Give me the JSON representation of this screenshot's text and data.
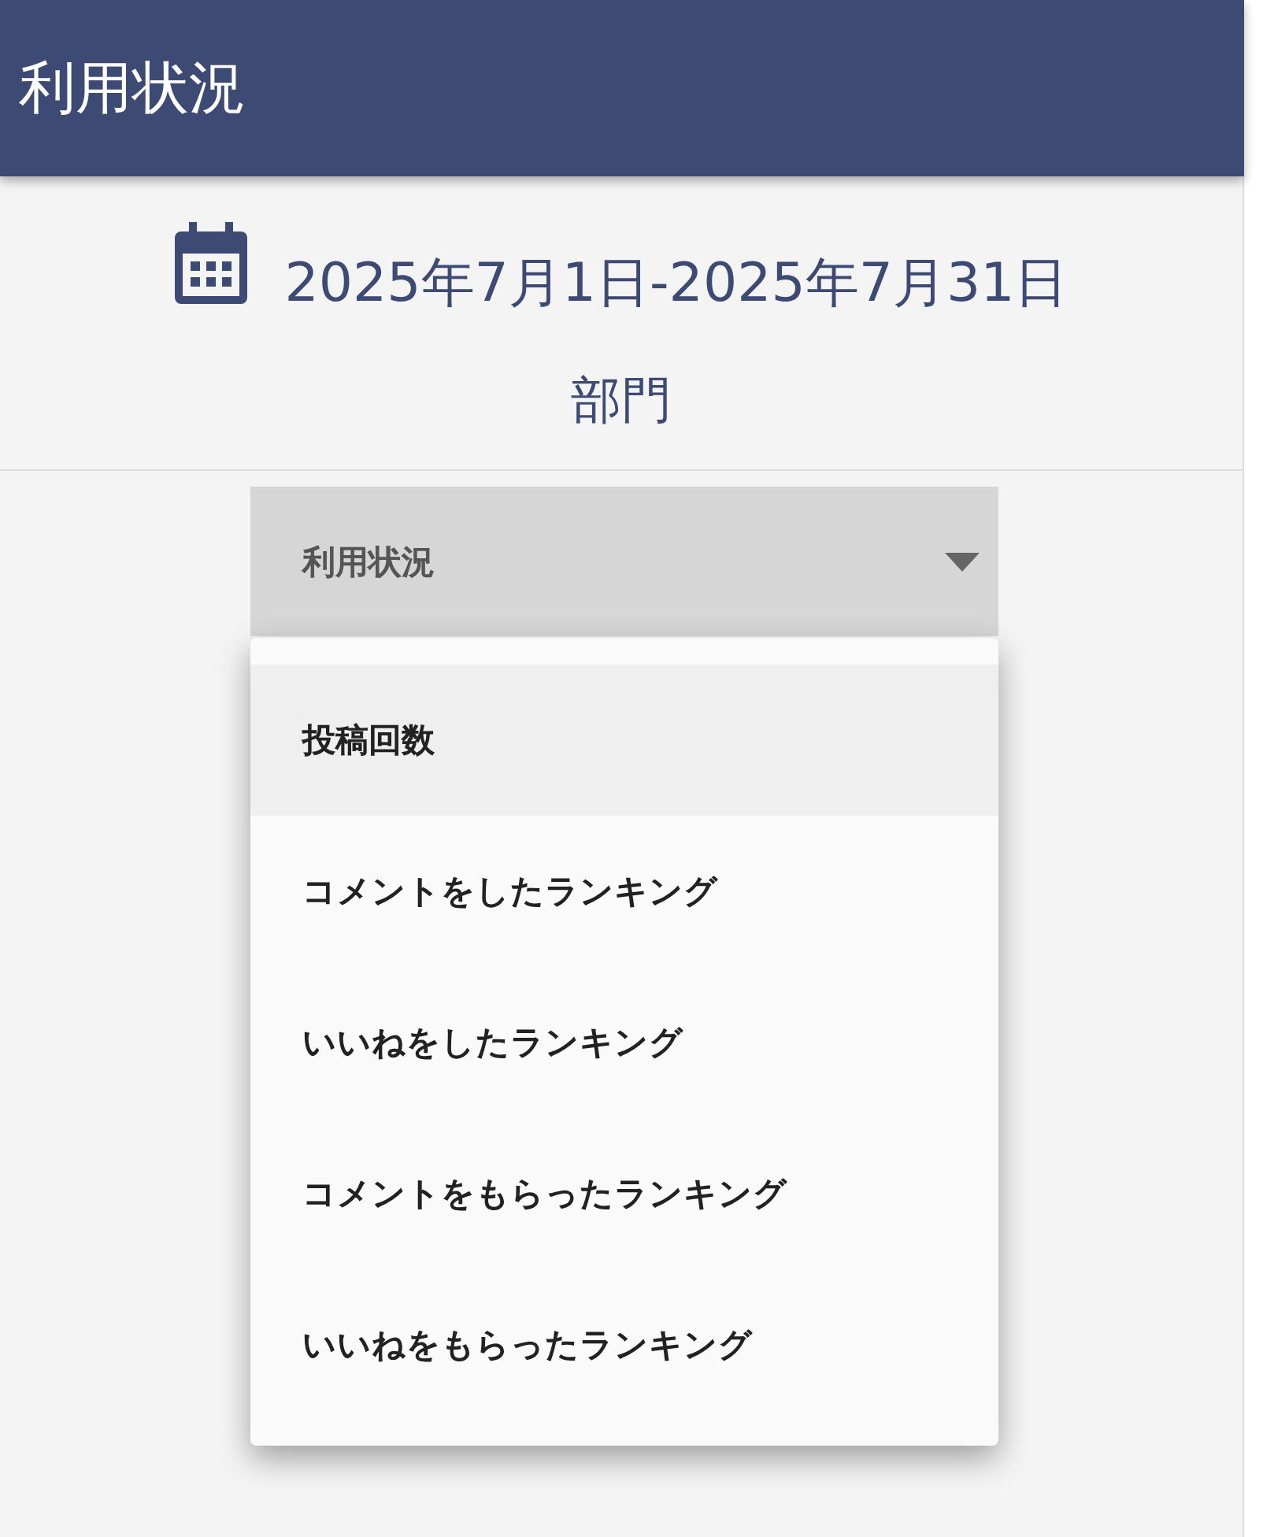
{
  "header": {
    "title": "利用状況"
  },
  "date_range": {
    "text": "2025年7月1日-2025年7月31日"
  },
  "department": {
    "label": "部門"
  },
  "select": {
    "value": "利用状況",
    "expanded": true
  },
  "menu": {
    "items": [
      {
        "label": "投稿回数",
        "selected": true
      },
      {
        "label": "コメントをしたランキング",
        "selected": false
      },
      {
        "label": "いいねをしたランキング",
        "selected": false
      },
      {
        "label": "コメントをもらったランキング",
        "selected": false
      },
      {
        "label": "いいねをもらったランキング",
        "selected": false
      }
    ]
  }
}
